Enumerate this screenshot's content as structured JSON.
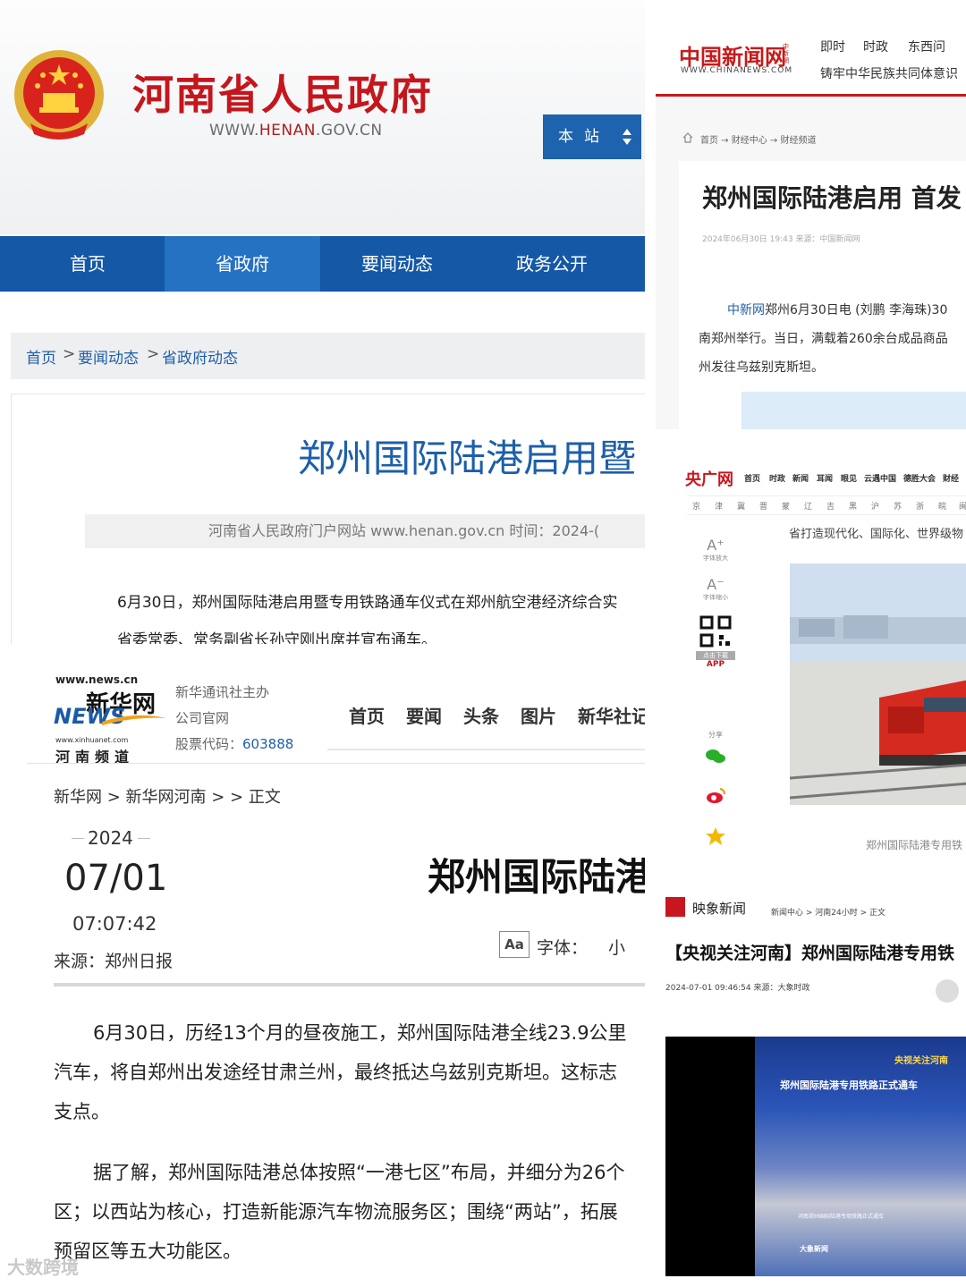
{
  "henan": {
    "site_title": "河南省人民政府",
    "url_prefix": "WWW.",
    "url_mid": "HENAN",
    "url_suffix": ".GOV.CN",
    "scope_select": "本站",
    "nav": [
      "首页",
      "省政府",
      "要闻动态",
      "政务公开"
    ],
    "breadcrumb": [
      "首页",
      ">",
      "要闻动态",
      ">",
      "省政府动态"
    ],
    "article_title": "郑州国际陆港启用暨",
    "meta": "河南省人民政府门户网站 www.henan.gov.cn   时间：2024-(",
    "paragraphs": [
      "6月30日，郑州国际陆港启用暨专用铁路通车仪式在郑州航空港经济综合实",
      "省委常委、常务副省长孙守刚出席并宣布通车。"
    ]
  },
  "chinanews": {
    "logo": "中国新闻网",
    "logo_side": "中新網",
    "logo_sub": "WWW.CHINANEWS.COM",
    "nav": [
      "即时",
      "时政",
      "东西问"
    ],
    "slogan": "铸牢中华民族共同体意识",
    "breadcrumb": "首页 → 财经中心 → 财经频道",
    "title": "郑州国际陆港启用 首发",
    "meta": "2024年06月30日 19:43   来源：中国新闻网",
    "para_source": "中新网",
    "paragraphs": [
      "郑州6月30日电 (刘鹏 李海珠)30",
      "南郑州举行。当日，满载着260余台成品商品",
      "州发往乌兹别克斯坦。"
    ]
  },
  "cctv": {
    "logo": "央广网",
    "nav": [
      "首页",
      "时政",
      "新闻",
      "耳闻",
      "眼见",
      "云遇中国",
      "德胜大会",
      "财经"
    ],
    "provinces": [
      "京",
      "津",
      "冀",
      "晋",
      "蒙",
      "辽",
      "吉",
      "黑",
      "沪",
      "苏",
      "浙",
      "皖",
      "闽"
    ],
    "tools": {
      "enlarge": "字体放大",
      "shrink": "字体缩小",
      "download": "点击下载",
      "app": "APP",
      "share": "分享"
    },
    "lead": "省打造现代化、国际化、世界级物",
    "caption": "郑州国际陆港专用铁"
  },
  "xinhua": {
    "logo_top": "www.news.cn",
    "logo_cn": "新华网",
    "logo_en": "NEWS",
    "logo_sub1": "www.xinhuanet.com",
    "logo_sub2": "河南频道",
    "info": [
      "新华通讯社主办",
      "公司官网"
    ],
    "stock_label": "股票代码：",
    "stock_code": "603888",
    "nav": [
      "首页",
      "要闻",
      "头条",
      "图片",
      "新华社记"
    ],
    "breadcrumb": "新华网 > 新华网河南 > > 正文",
    "year": "2024",
    "date": "07/01",
    "time": "07:07:42",
    "source": "来源：郑州日报",
    "title": "郑州国际陆港",
    "font_label": "字体：",
    "font_value": "小",
    "font_icon": "Aa",
    "paragraphs": [
      "6月30日，历经13个月的昼夜施工，郑州国际陆港全线23.9公里",
      "汽车，将自郑州出发途经甘肃兰州，最终抵达乌兹别克斯坦。这标志",
      "支点。",
      "据了解，郑州国际陆港总体按照“一港七区”布局，并细分为26个",
      "区；以西站为核心，打造新能源汽车物流服务区；围绕“两站”，拓展",
      "预留区等五大功能区。"
    ],
    "watermark": "大数跨境"
  },
  "yingxiang": {
    "brand": "映象新闻",
    "breadcrumb": "新闻中心 > 河南24小时 > 正文",
    "title": "【央视关注河南】郑州国际陆港专用铁",
    "meta": "2024-07-01 09:46:54   来源：大象时政",
    "video_tag": "央视关注河南",
    "video_title": "郑州国际陆港专用铁路正式通车",
    "video_sub": "河南郑州国际陆港专用铁路正式通车",
    "video_foot": "大象新闻"
  },
  "colors": {
    "henan_red": "#c4161c",
    "henan_blue": "#1458a6",
    "chinanews_red": "#c61a1a",
    "link_blue": "#1f5fa8"
  }
}
